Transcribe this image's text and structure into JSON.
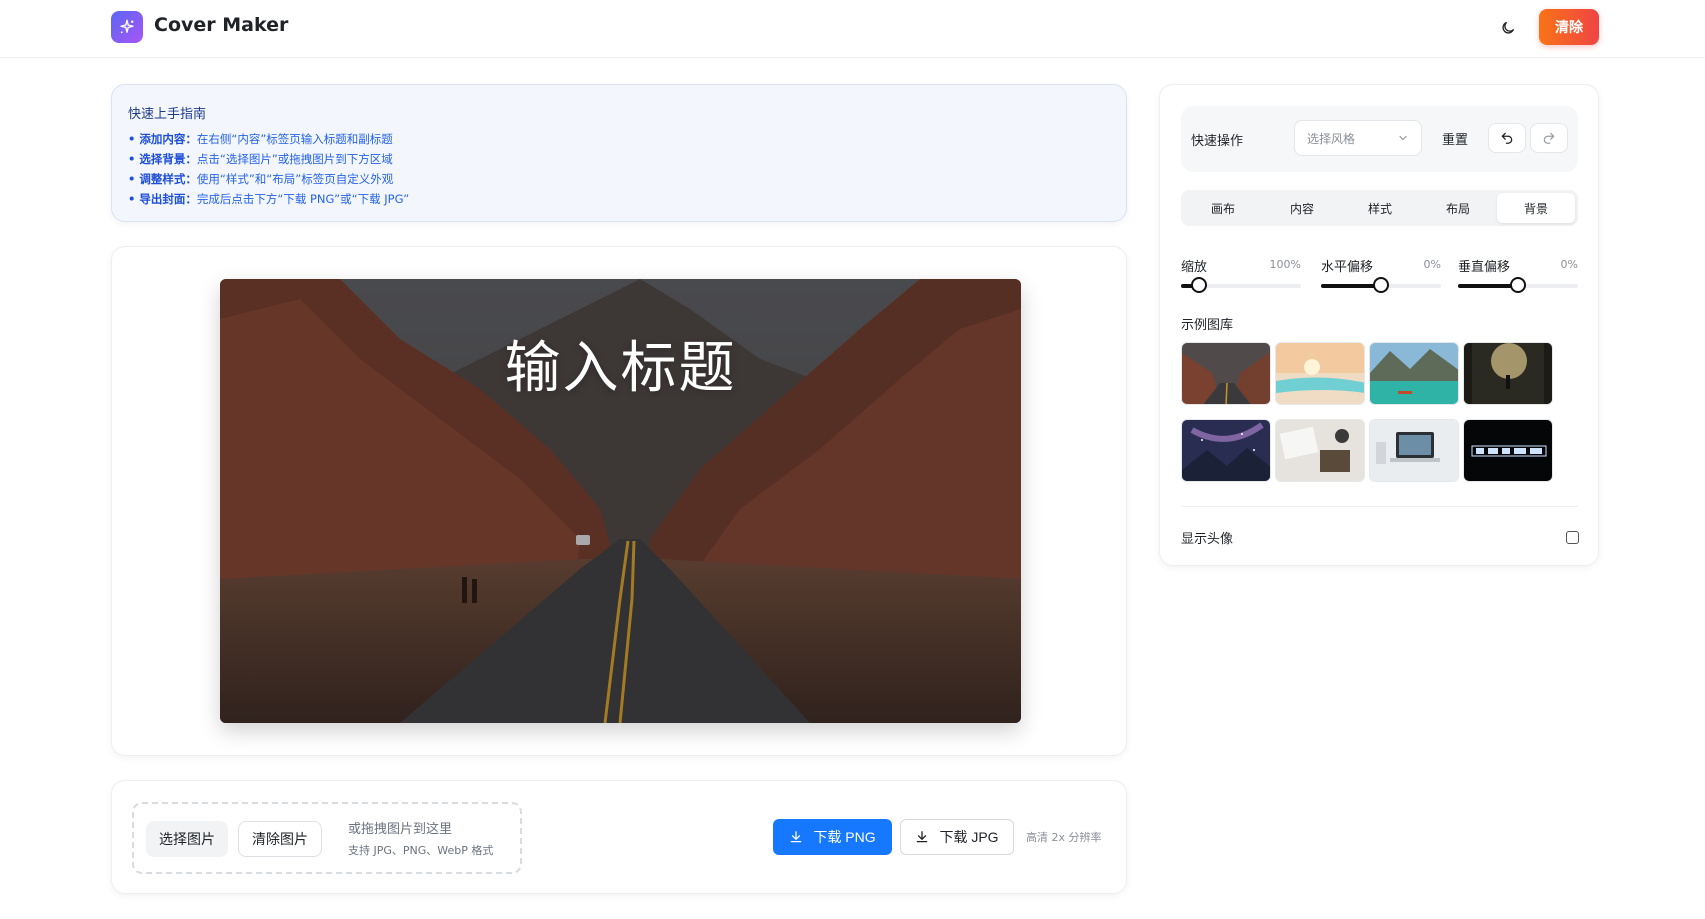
{
  "header": {
    "brand": "Cover Maker",
    "theme_icon": "moon-icon",
    "clear_label": "清除",
    "accent_colors": [
      "#f97316",
      "#ef4444"
    ]
  },
  "guide": {
    "title": "快速上手指南",
    "items": [
      {
        "label": "• 添加内容：",
        "text": "在右侧“内容”标签页输入标题和副标题"
      },
      {
        "label": "• 选择背景：",
        "text": "点击“选择图片”或拖拽图片到下方区域"
      },
      {
        "label": "• 调整样式：",
        "text": "使用“样式”和“布局”标签页自定义外观"
      },
      {
        "label": "• 导出封面：",
        "text": "完成后点击下方“下载 PNG”或“下载 JPG”"
      }
    ]
  },
  "canvas": {
    "title": "输入标题",
    "background": "desert canyon road"
  },
  "upload": {
    "select_label": "选择图片",
    "clear_label": "清除图片",
    "hint": "或拖拽图片到这里",
    "formats": "支持 JPG、PNG、WebP 格式"
  },
  "download": {
    "png_label": "下载 PNG",
    "jpg_label": "下载 JPG",
    "note": "高清 2x 分辨率",
    "png_color": "#1677ff"
  },
  "panel": {
    "quick_label": "快速操作",
    "style_placeholder": "选择风格",
    "reset_label": "重置",
    "undo_icon": "undo-icon",
    "redo_icon": "redo-icon",
    "tabs": [
      "画布",
      "内容",
      "样式",
      "布局",
      "背景"
    ],
    "active_tab": "背景",
    "sliders": [
      {
        "label": "缩放",
        "value": "100%",
        "fraction": 0.15
      },
      {
        "label": "水平偏移",
        "value": "0%",
        "fraction": 0.5
      },
      {
        "label": "垂直偏移",
        "value": "0%",
        "fraction": 0.5
      }
    ],
    "gallery_label": "示例图库",
    "gallery": [
      "canyon road",
      "beach sunset",
      "turquoise lake",
      "forest light",
      "starry mountains",
      "desk items",
      "laptop workspace",
      "neon text"
    ],
    "avatar_label": "显示头像",
    "avatar_checked": false
  }
}
